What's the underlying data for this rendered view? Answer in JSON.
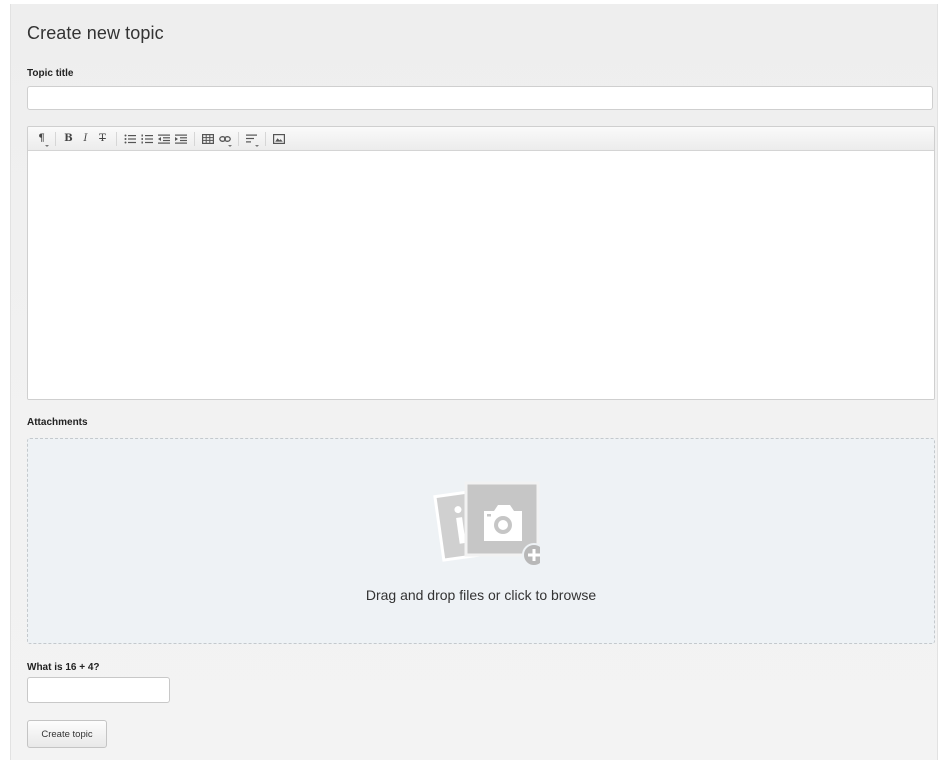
{
  "form": {
    "heading": "Create new topic",
    "title_label": "Topic title",
    "title_value": "",
    "title_placeholder": "",
    "body_value": "",
    "attachments_label": "Attachments",
    "dropzone_text": "Drag and drop files or click to browse",
    "captcha_label": "What is 16 + 4?",
    "captcha_value": "",
    "submit_label": "Create topic"
  },
  "toolbar": {
    "buttons": [
      {
        "icon": "paragraph-format-icon",
        "glyph": "¶"
      },
      {
        "icon": "bold-icon",
        "glyph": "B"
      },
      {
        "icon": "italic-icon",
        "glyph": "I"
      },
      {
        "icon": "strikethrough-icon",
        "glyph": "T"
      },
      {
        "icon": "unordered-list-icon"
      },
      {
        "icon": "ordered-list-icon"
      },
      {
        "icon": "outdent-icon"
      },
      {
        "icon": "indent-icon"
      },
      {
        "icon": "table-icon"
      },
      {
        "icon": "link-icon"
      },
      {
        "icon": "align-icon"
      },
      {
        "icon": "image-icon"
      }
    ]
  },
  "colors": {
    "panel_background": "#f0f0f0",
    "dropzone_background": "#eef2f5",
    "dropzone_border": "#c4c9cd",
    "icon_gray": "#c9c9c9"
  }
}
